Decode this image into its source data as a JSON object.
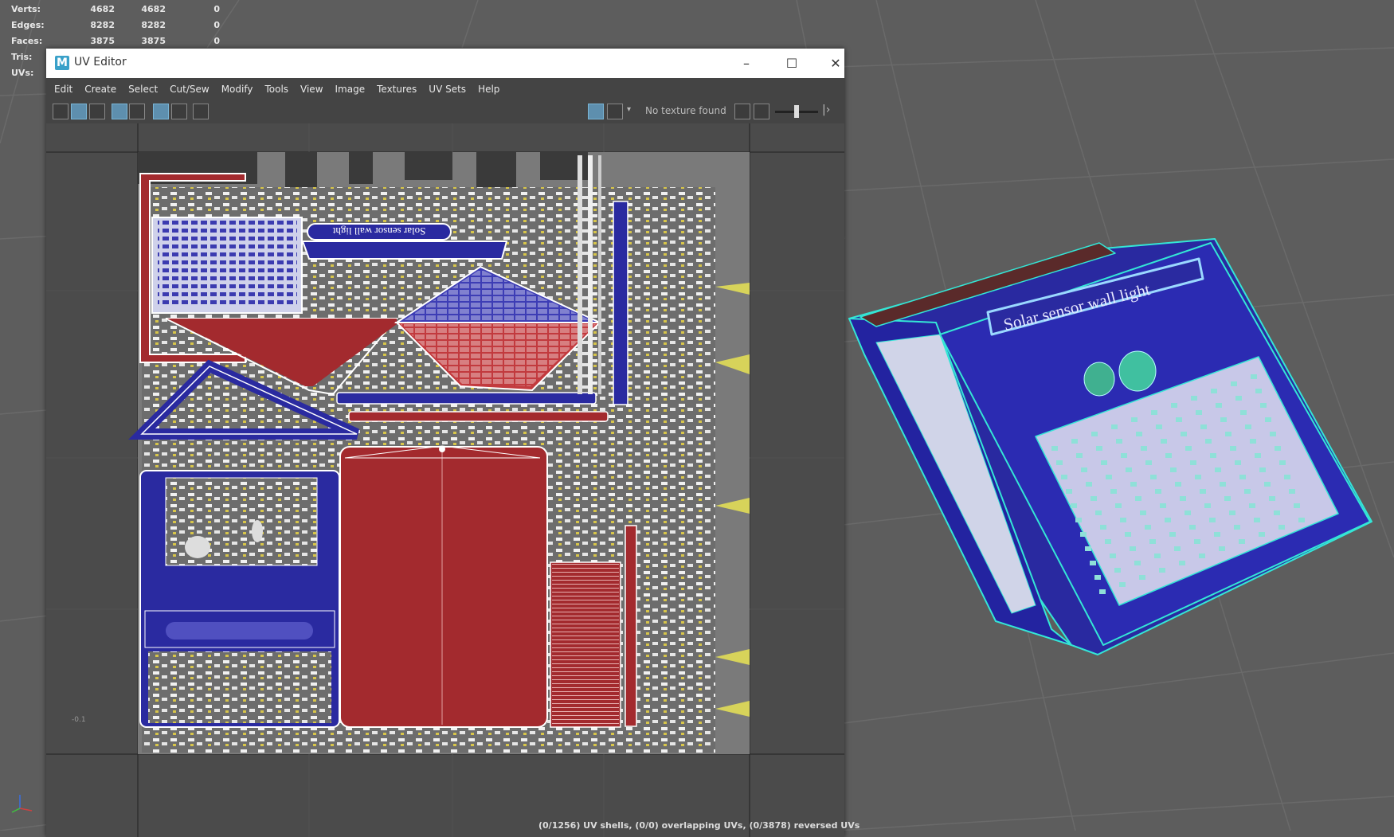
{
  "hud": {
    "rows": [
      {
        "label": "Verts:",
        "v1": "4682",
        "v2": "4682",
        "v3": "0"
      },
      {
        "label": "Edges:",
        "v1": "8282",
        "v2": "8282",
        "v3": "0"
      },
      {
        "label": "Faces:",
        "v1": "3875",
        "v2": "3875",
        "v3": "0"
      },
      {
        "label": "Tris:",
        "v1": "",
        "v2": "",
        "v3": ""
      },
      {
        "label": "UVs:",
        "v1": "",
        "v2": "",
        "v3": ""
      }
    ]
  },
  "window": {
    "title": "UV Editor",
    "app_icon_letter": "M",
    "minimize": "–",
    "maximize": "☐",
    "close": "✕"
  },
  "menu": [
    "Edit",
    "Create",
    "Select",
    "Cut/Sew",
    "Modify",
    "Tools",
    "View",
    "Image",
    "Textures",
    "UV Sets",
    "Help"
  ],
  "toolbar": {
    "texture_status": "No texture found"
  },
  "uv": {
    "label_text": "Solar sensor wall light",
    "axis_label": "-0.1",
    "status": "(0/1256) UV shells, (0/0) overlapping UVs, (0/3878) reversed UVs"
  },
  "model": {
    "label_text": "Solar sensor wall light"
  },
  "colors": {
    "viewport_bg": "#5d5d5d",
    "uv_blue": "#2f2fa8",
    "uv_red": "#9b2428",
    "wire": "#34e6d6"
  }
}
